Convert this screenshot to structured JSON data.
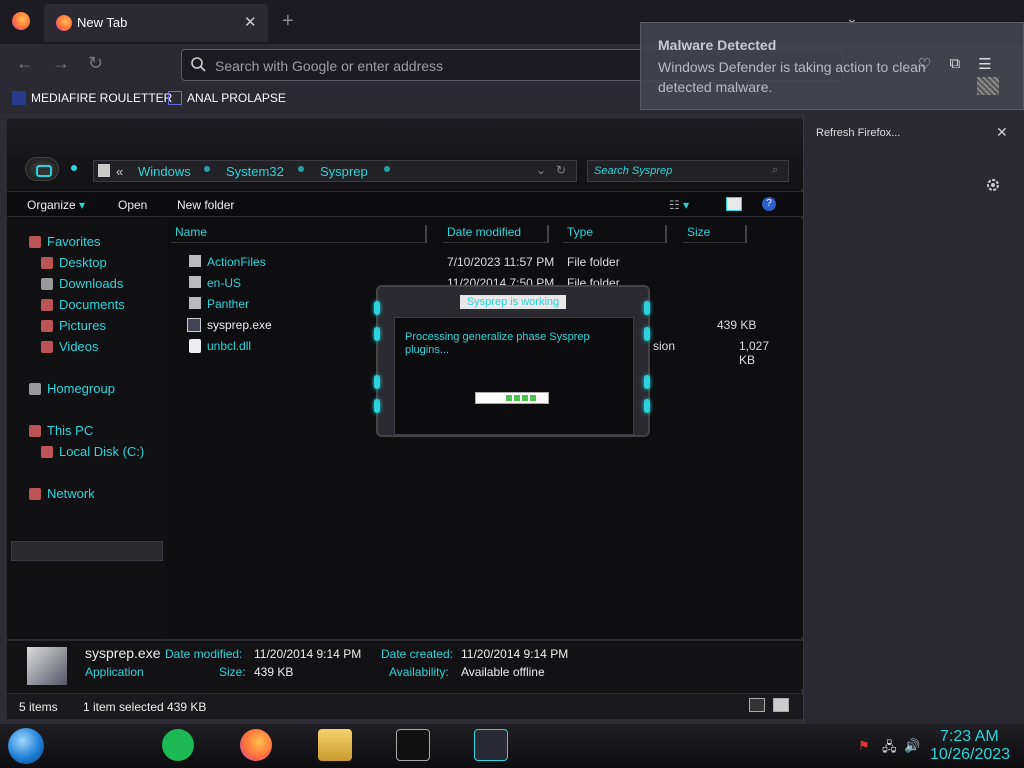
{
  "browser": {
    "tab_title": "New Tab",
    "url_placeholder": "Search with Google or enter address",
    "bookmarks": [
      {
        "label": "MEDIAFIRE ROULETTER"
      },
      {
        "label": "ANAL PROLAPSE"
      }
    ],
    "sidebar_title": "Refresh Firefox..."
  },
  "notification": {
    "title": "Malware Detected",
    "body": "Windows Defender is taking action to clean detected malware."
  },
  "explorer": {
    "breadcrumb": [
      "Windows",
      "System32",
      "Sysprep"
    ],
    "breadcrumb_prefix": "«",
    "search_placeholder": "Search Sysprep",
    "commands": [
      "Organize",
      "Open",
      "New folder"
    ],
    "nav": {
      "favorites": "Favorites",
      "desktop": "Desktop",
      "downloads": "Downloads",
      "documents": "Documents",
      "pictures": "Pictures",
      "videos": "Videos",
      "homegroup": "Homegroup",
      "thispc": "This PC",
      "localdisk": "Local Disk (C:)",
      "network": "Network"
    },
    "columns": [
      "Name",
      "Date modified",
      "Type",
      "Size"
    ],
    "files": [
      {
        "name": "ActionFiles",
        "date": "7/10/2023 11:57 PM",
        "type": "File folder",
        "size": ""
      },
      {
        "name": "en-US",
        "date": "11/20/2014 7:50 PM",
        "type": "File folder",
        "size": ""
      },
      {
        "name": "Panther",
        "date": "",
        "type": "",
        "size": ""
      },
      {
        "name": "sysprep.exe",
        "date": "",
        "type": "",
        "size": "439 KB"
      },
      {
        "name": "unbcl.dll",
        "date": "",
        "type": "sion",
        "size": "1,027 KB"
      }
    ],
    "details": {
      "filename": "sysprep.exe",
      "filetype": "Application",
      "modified_label": "Date modified:",
      "modified_value": "11/20/2014 9:14 PM",
      "size_label": "Size:",
      "size_value": "439 KB",
      "created_label": "Date created:",
      "created_value": "11/20/2014 9:14 PM",
      "avail_label": "Availability:",
      "avail_value": "Available offline"
    },
    "status": {
      "items": "5 items",
      "selected": "1 item selected  439 KB"
    }
  },
  "dialog": {
    "title": "Sysprep is working",
    "message": "Processing generalize phase Sysprep plugins..."
  },
  "taskbar": {
    "time": "7:23 AM",
    "date": "10/26/2023"
  }
}
